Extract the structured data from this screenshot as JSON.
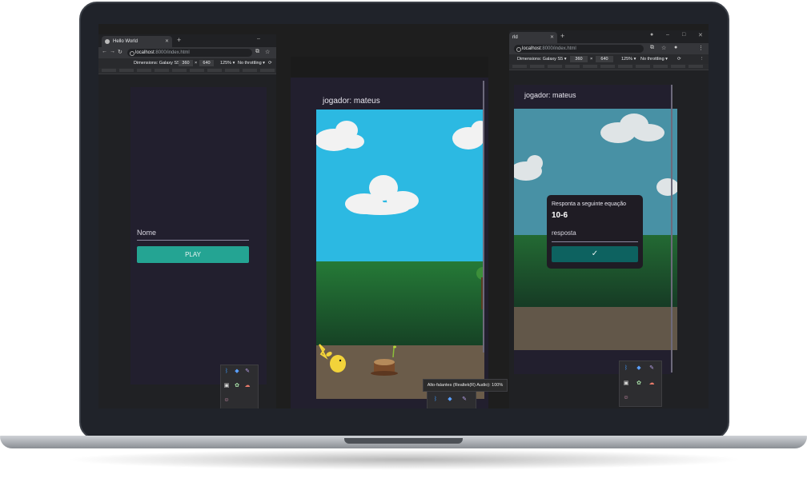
{
  "left_window": {
    "tab_title": "Hello World",
    "url_host": "localhost",
    "url_path": ":8000/index.html",
    "device_label": "Dimensions: Galaxy S5 ▾",
    "width": "360",
    "height": "640",
    "times": "×",
    "zoom": "125% ▾",
    "throttling": "No throttling ▾",
    "name_label": "Nome",
    "play_label": "PLAY"
  },
  "middle_window": {
    "player_label": "jogador: mateus"
  },
  "right_window": {
    "tab_title": "rld",
    "url_host": "localhost",
    "url_path": ":8000/index.html",
    "device_label": "Dimensions: Galaxy S5 ▾",
    "width": "360",
    "height": "640",
    "times": "×",
    "zoom": "125% ▾",
    "throttling": "No throttling ▾",
    "player_label": "jogador: mateus",
    "dialog_title": "Responta a seguinte equação",
    "equation": "10-6",
    "answer_placeholder": "resposta",
    "confirm_icon": "✓"
  },
  "tooltip": {
    "text": "Alto-falantes (Realtek(R) Audio): 100%"
  },
  "colors": {
    "play_button": "#24a493",
    "confirm_button": "#0d6260",
    "sky": "#2cb9e2",
    "phone_bg": "#221f2e"
  },
  "icons": [
    "bluetooth-icon",
    "security-icon",
    "pen-icon",
    "store-icon",
    "app-icon",
    "cloud-icon",
    "character-icon"
  ]
}
